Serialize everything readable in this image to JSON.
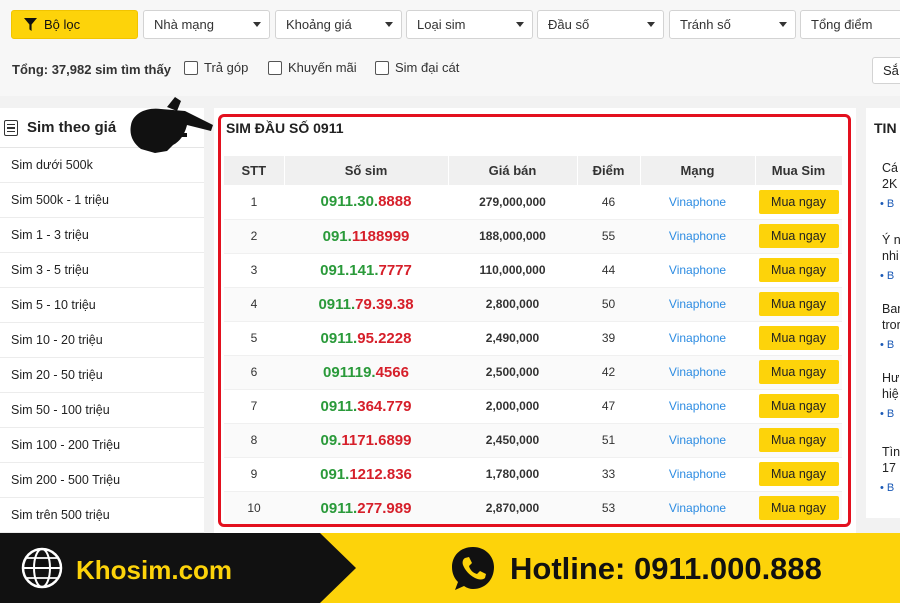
{
  "filters": {
    "filter_label": "Bộ lọc",
    "network": "Nhà mạng",
    "price_range": "Khoảng giá",
    "sim_type": "Loại sim",
    "prefix": "Đầu số",
    "avoid": "Tránh số",
    "total_points": "Tổng điểm"
  },
  "result_text": "Tổng: 37,982 sim tìm thấy",
  "options": {
    "installment": "Trả góp",
    "promotion": "Khuyến mãi",
    "grand_sim": "Sim đại cát"
  },
  "sort_label": "Sắ",
  "sidebar": {
    "title": "Sim theo giá",
    "items": [
      "Sim dưới 500k",
      "Sim 500k - 1 triệu",
      "Sim 1 - 3 triệu",
      "Sim 3 - 5 triệu",
      "Sim 5 - 10 triệu",
      "Sim 10 - 20 triệu",
      "Sim 20 - 50 triệu",
      "Sim 50 - 100 triệu",
      "Sim 100 - 200 Triệu",
      "Sim 200 - 500 Triệu",
      "Sim trên 500 triệu"
    ]
  },
  "main": {
    "title": "SIM ĐẦU SỐ 0911",
    "headers": [
      "STT",
      "Số sim",
      "Giá bán",
      "Điểm",
      "Mạng",
      "Mua Sim"
    ],
    "buy_label": "Mua ngay",
    "rows": [
      {
        "stt": "1",
        "num_a": "0911.30.",
        "num_b": "8888",
        "price": "279,000,000",
        "point": "46",
        "net": "Vinaphone"
      },
      {
        "stt": "2",
        "num_a": "091.",
        "num_b": "1188999",
        "price": "188,000,000",
        "point": "55",
        "net": "Vinaphone"
      },
      {
        "stt": "3",
        "num_a": "091.141.",
        "num_b": "7777",
        "price": "110,000,000",
        "point": "44",
        "net": "Vinaphone"
      },
      {
        "stt": "4",
        "num_a": "0911.",
        "num_b": "79.39.38",
        "price": "2,800,000",
        "point": "50",
        "net": "Vinaphone"
      },
      {
        "stt": "5",
        "num_a": "0911.",
        "num_b": "95.2228",
        "price": "2,490,000",
        "point": "39",
        "net": "Vinaphone"
      },
      {
        "stt": "6",
        "num_a": "091119.",
        "num_b": "4566",
        "price": "2,500,000",
        "point": "42",
        "net": "Vinaphone"
      },
      {
        "stt": "7",
        "num_a": "0911.",
        "num_b": "364.779",
        "price": "2,000,000",
        "point": "47",
        "net": "Vinaphone"
      },
      {
        "stt": "8",
        "num_a": "09.",
        "num_b": "1171.6899",
        "price": "2,450,000",
        "point": "51",
        "net": "Vinaphone"
      },
      {
        "stt": "9",
        "num_a": "091.",
        "num_b": "1212.836",
        "price": "1,780,000",
        "point": "33",
        "net": "Vinaphone"
      },
      {
        "stt": "10",
        "num_a": "0911.",
        "num_b": "277.989",
        "price": "2,870,000",
        "point": "53",
        "net": "Vinaphone"
      }
    ]
  },
  "right_panel": {
    "title": "TIN",
    "news": [
      "Cá\n2K",
      "Ý n\nnhi",
      "Bar\ntror",
      "Hư\nhiệ",
      "Tìn\n17"
    ],
    "bullet": "• B"
  },
  "banner": {
    "brand": "Khosim.com",
    "hotline": "Hotline: 0911.000.888"
  },
  "colors": {
    "accent": "#fdd30a",
    "highlight_border": "#e3101e",
    "green_digits": "#2a9a3a",
    "red_digits": "#d61f2a",
    "network_blue": "#2d8ce2"
  }
}
